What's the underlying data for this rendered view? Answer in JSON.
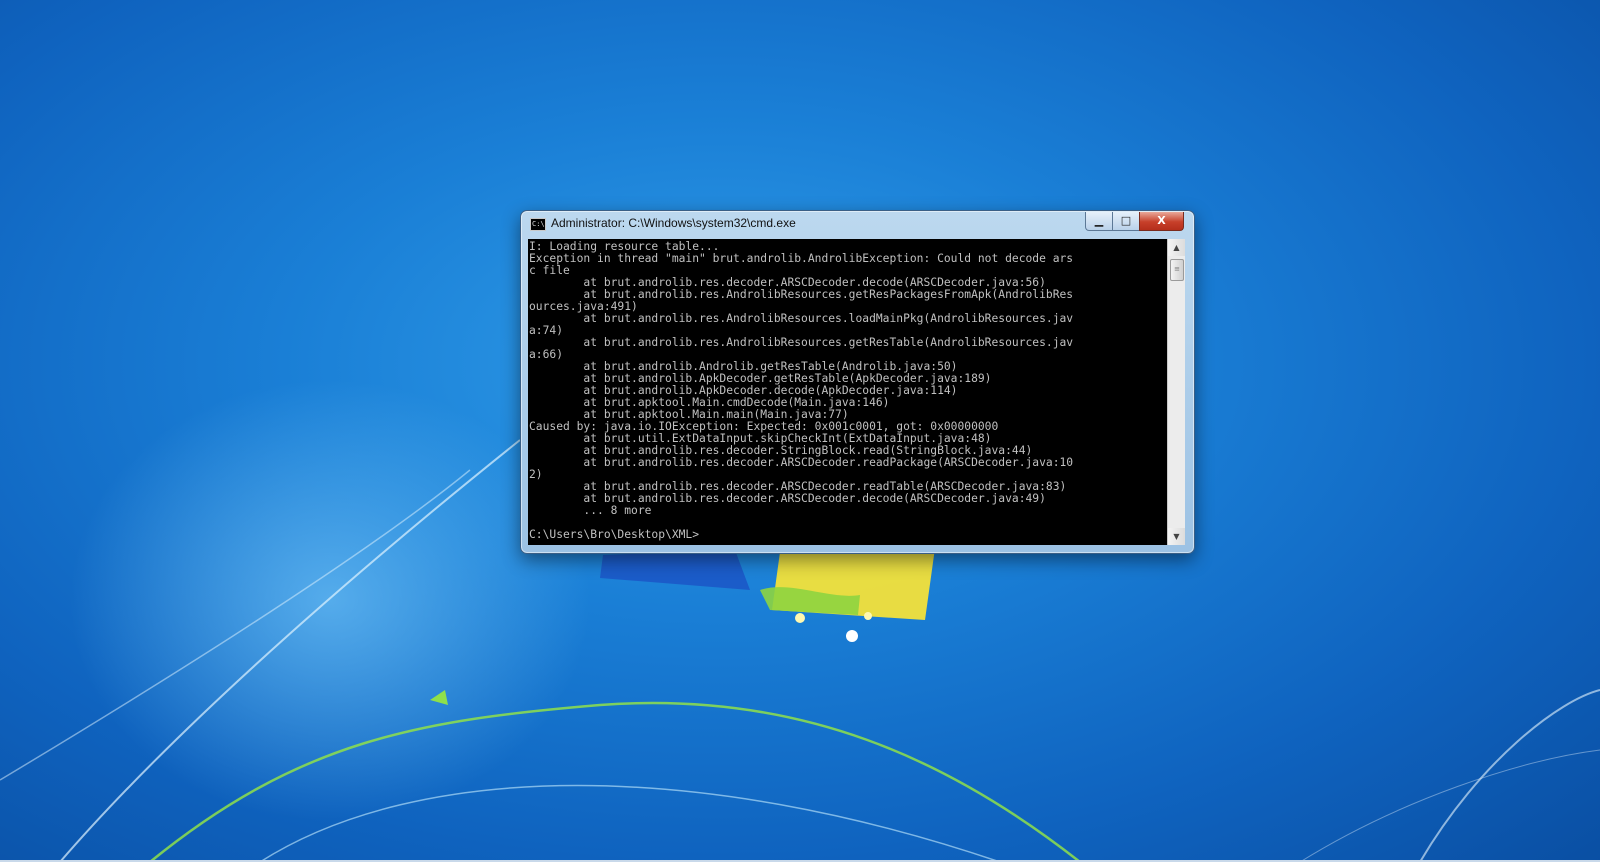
{
  "window": {
    "title": "Administrator: C:\\Windows\\system32\\cmd.exe",
    "icon_glyph": "C:\\",
    "minimize_glyph": "▁",
    "maximize_glyph": "□",
    "close_glyph": "X"
  },
  "console": {
    "text": "I: Loading resource table...\nException in thread \"main\" brut.androlib.AndrolibException: Could not decode ars\nc file\n        at brut.androlib.res.decoder.ARSCDecoder.decode(ARSCDecoder.java:56)\n        at brut.androlib.res.AndrolibResources.getResPackagesFromApk(AndrolibRes\nources.java:491)\n        at brut.androlib.res.AndrolibResources.loadMainPkg(AndrolibResources.jav\na:74)\n        at brut.androlib.res.AndrolibResources.getResTable(AndrolibResources.jav\na:66)\n        at brut.androlib.Androlib.getResTable(Androlib.java:50)\n        at brut.androlib.ApkDecoder.getResTable(ApkDecoder.java:189)\n        at brut.androlib.ApkDecoder.decode(ApkDecoder.java:114)\n        at brut.apktool.Main.cmdDecode(Main.java:146)\n        at brut.apktool.Main.main(Main.java:77)\nCaused by: java.io.IOException: Expected: 0x001c0001, got: 0x00000000\n        at brut.util.ExtDataInput.skipCheckInt(ExtDataInput.java:48)\n        at brut.androlib.res.decoder.StringBlock.read(StringBlock.java:44)\n        at brut.androlib.res.decoder.ARSCDecoder.readPackage(ARSCDecoder.java:10\n2)\n        at brut.androlib.res.decoder.ARSCDecoder.readTable(ARSCDecoder.java:83)\n        at brut.androlib.res.decoder.ARSCDecoder.decode(ARSCDecoder.java:49)\n        ... 8 more\n\nC:\\Users\\Bro\\Desktop\\XML>"
  },
  "scrollbar": {
    "up_glyph": "▲",
    "down_glyph": "▼",
    "thumb_glyph": "≡"
  },
  "colors": {
    "desktop_blue": "#1a7fd6",
    "console_bg": "#000000",
    "console_fg": "#c0c0c0",
    "close_red": "#c7402a"
  }
}
